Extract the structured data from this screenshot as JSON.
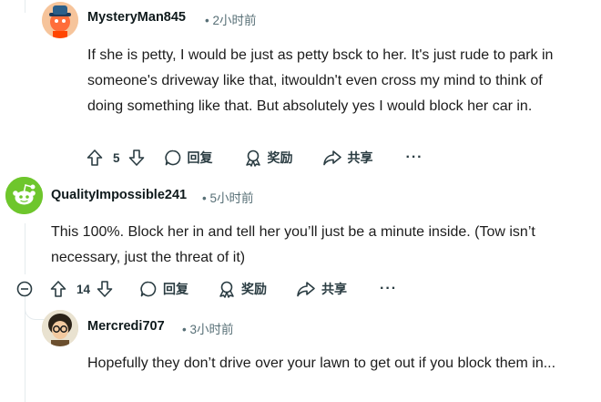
{
  "comments": [
    {
      "username": "MysteryMan845",
      "time": "• 2小时前",
      "body": [
        "If she is petty, I would be just as petty bsck to her. It's just rude to park in someone's driveway like that, itwouldn't even cross my mind to think of doing something like that. But absolutely yes I would block her car in."
      ],
      "votes": "5",
      "reply_label": "回复",
      "award_label": "奖励",
      "share_label": "共享",
      "more_label": "···",
      "avatar_icon": "fedora-avatar-icon"
    },
    {
      "username": "QualityImpossible241",
      "time": "• 5小时前",
      "body": [
        "This 100%. Block her in and tell her you’ll just be a minute inside. (Tow isn’t necessary, just the threat of it)"
      ],
      "votes": "14",
      "reply_label": "回复",
      "award_label": "奖励",
      "share_label": "共享",
      "more_label": "···",
      "avatar_icon": "default-snoo-avatar-icon"
    },
    {
      "username": "Mercredi707",
      "time": "• 3小时前",
      "body": [
        "Hopefully they don’t drive over your lawn to get out if you block them in..."
      ],
      "avatar_icon": "glasses-avatar-icon"
    }
  ],
  "colors": {
    "accent_green": "#6ec62c",
    "text_muted": "#576f76",
    "thread_line": "#e5ebee"
  }
}
